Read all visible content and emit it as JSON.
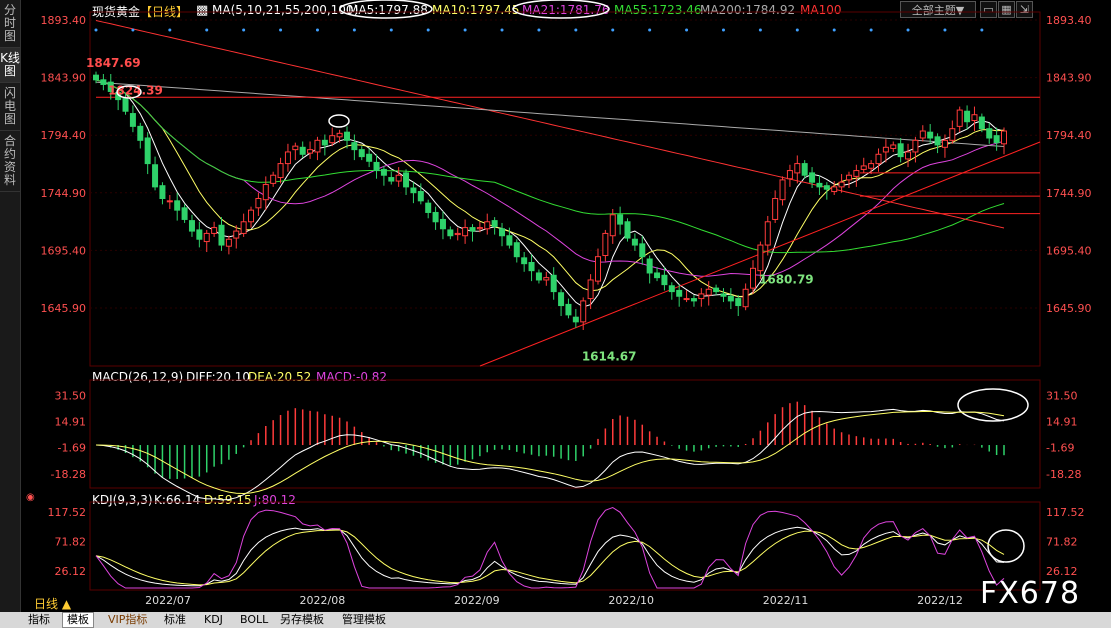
{
  "sidebar": {
    "tabs": [
      {
        "label": "分时图",
        "active": false
      },
      {
        "label": "K线图",
        "active": true
      },
      {
        "label": "闪电图",
        "active": false
      },
      {
        "label": "合约资料",
        "active": false
      }
    ]
  },
  "header": {
    "symbol": "现货黄金",
    "period": "【日线】",
    "ma_prefix": "MA(5,10,21,55,200,100)",
    "ma5": "MA5:1797.88",
    "ma10": "MA10:1797.45",
    "ma21": "MA21:1781.76",
    "ma55": "MA55:1723.46",
    "ma200": "MA200:1784.92",
    "ma100": "MA100",
    "theme": "全部主题",
    "theme_arrow": "▼"
  },
  "macd_header": {
    "name": "MACD(26,12,9)",
    "diff": "DIFF:20.10",
    "dea": "DEA:20.52",
    "macd": "MACD:-0.82"
  },
  "kdj_header": {
    "name": "KDJ(9,3,3)",
    "k": "K:66.14",
    "d": "D:59.15",
    "j": "J:80.12"
  },
  "period_label": "日线",
  "period_arrow": "▲",
  "bottom_tabs": [
    "指标",
    "模板",
    "VIP指标",
    "标准",
    "KDJ",
    "BOLL",
    "另存模板",
    "管理模板"
  ],
  "watermark": "FX678",
  "colors": {
    "up": "#ff3b3b",
    "down": "#2fd26a",
    "ma5": "#ffffff",
    "ma10": "#ffff66",
    "ma21": "#dd44dd",
    "ma55": "#33dd33",
    "ma200": "#aaaaaa",
    "ma100": "#ff3333",
    "axis": "#ff5050"
  },
  "chart_data": [
    {
      "type": "candlestick",
      "title": "现货黄金【日线】",
      "ylim": [
        1614.67,
        1893.4
      ],
      "y_ticks": [
        "1893.40",
        "1843.90",
        "1794.40",
        "1744.90",
        "1695.40",
        "1645.90"
      ],
      "x_ticks": [
        "2022/07",
        "2022/08",
        "2022/09",
        "2022/10",
        "2022/11",
        "2022/12"
      ],
      "annotations": [
        {
          "label": "1847.69",
          "value": 1847.69,
          "date": "2022/07"
        },
        {
          "label": "1680.79",
          "value": 1680.79,
          "date": "2022/07"
        },
        {
          "label": "1614.67",
          "value": 1614.67,
          "date": "2022/09"
        },
        {
          "label": "1824.39",
          "value": 1824.39,
          "date": "2022/12"
        }
      ],
      "series": [
        {
          "name": "MA5",
          "last": 1797.88
        },
        {
          "name": "MA10",
          "last": 1797.45
        },
        {
          "name": "MA21",
          "last": 1781.76
        },
        {
          "name": "MA55",
          "last": 1723.46
        },
        {
          "name": "MA200",
          "last": 1784.92
        },
        {
          "name": "MA100"
        }
      ],
      "close": [
        1842,
        1838,
        1832,
        1825,
        1815,
        1802,
        1790,
        1770,
        1750,
        1740,
        1738,
        1730,
        1722,
        1712,
        1705,
        1710,
        1715,
        1700,
        1705,
        1712,
        1720,
        1730,
        1740,
        1752,
        1760,
        1770,
        1780,
        1785,
        1778,
        1782,
        1790,
        1786,
        1794,
        1796,
        1790,
        1782,
        1776,
        1772,
        1764,
        1760,
        1755,
        1760,
        1750,
        1745,
        1738,
        1728,
        1720,
        1714,
        1708,
        1710,
        1715,
        1712,
        1715,
        1720,
        1716,
        1708,
        1700,
        1690,
        1684,
        1678,
        1670,
        1672,
        1660,
        1648,
        1640,
        1634,
        1652,
        1670,
        1690,
        1710,
        1726,
        1718,
        1706,
        1700,
        1690,
        1676,
        1672,
        1666,
        1660,
        1656,
        1654,
        1652,
        1658,
        1662,
        1660,
        1656,
        1652,
        1648,
        1662,
        1680,
        1700,
        1720,
        1740,
        1756,
        1764,
        1770,
        1760,
        1754,
        1750,
        1748,
        1750,
        1754,
        1760,
        1764,
        1768,
        1770,
        1778,
        1784,
        1786,
        1776,
        1780,
        1790,
        1798,
        1792,
        1786,
        1790,
        1800,
        1816,
        1806,
        1812,
        1800,
        1792,
        1788,
        1798
      ]
    },
    {
      "type": "line",
      "title": "MACD(26,12,9)",
      "y_ticks": [
        "31.50",
        "14.91",
        "-1.69",
        "-18.28"
      ],
      "ylim": [
        -26,
        40
      ],
      "series": [
        {
          "name": "DIFF",
          "last": 20.1
        },
        {
          "name": "DEA",
          "last": 20.52
        },
        {
          "name": "MACD",
          "last": -0.82
        }
      ]
    },
    {
      "type": "line",
      "title": "KDJ(9,3,3)",
      "y_ticks": [
        "117.52",
        "71.82",
        "26.12"
      ],
      "ylim": [
        0,
        130
      ],
      "series": [
        {
          "name": "K",
          "last": 66.14
        },
        {
          "name": "D",
          "last": 59.15
        },
        {
          "name": "J",
          "last": 80.12
        }
      ]
    }
  ]
}
